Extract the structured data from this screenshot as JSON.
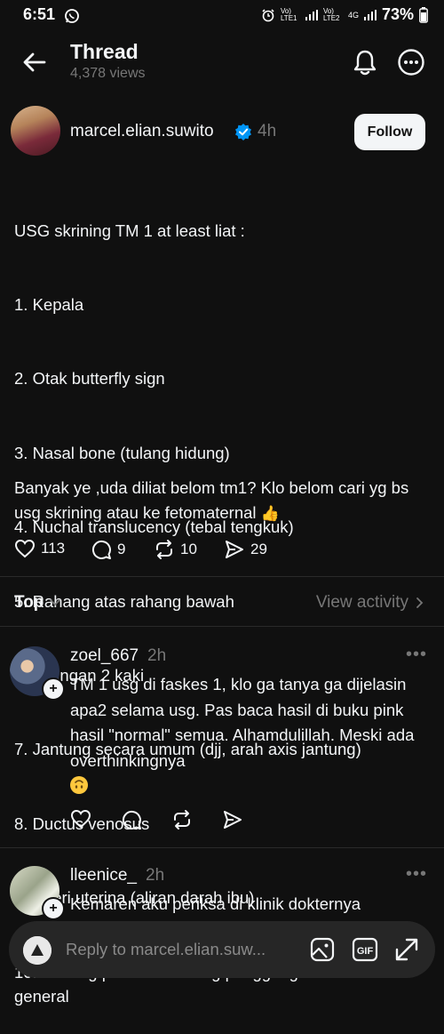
{
  "status_bar": {
    "time": "6:51",
    "battery": "73%",
    "signal_labels": [
      "Vo) LTE1",
      "Vo) LTE2",
      "4G"
    ]
  },
  "header": {
    "title": "Thread",
    "views": "4,378 views"
  },
  "post": {
    "author": "marcel.elian.suwito",
    "time": "4h",
    "follow_label": "Follow",
    "lines": [
      "USG skrining TM 1 at least liat :",
      "1. Kepala",
      "2. Otak butterfly sign",
      "3. Nasal bone (tulang hidung)",
      "4. Nuchal translucency (tebal tengkuk)",
      "5. Rahang atas rahang bawah",
      "6. 2 tangan 2 kaki",
      "7. Jantung secara umum (djj, arah axis jantung)",
      "8. Ductus venosus",
      "9. Arteri uterina (aliran darah ibu)",
      "10. Dinding perut dan tulang punggung in general"
    ],
    "text2": "Banyak ye ,uda diliat belom tm1? Klo belom cari yg bs usg skrining atau ke fetomaternal",
    "emoji": "👍",
    "likes": "113",
    "replies": "9",
    "reposts": "10",
    "shares": "29"
  },
  "sort": {
    "label": "Top",
    "view_activity": "View activity"
  },
  "replies": [
    {
      "author": "zoel_667",
      "time": "2h",
      "text": "TM 1 usg di faskes 1, klo ga tanya ga dijelasin apa2 selama usg. Pas baca hasil di buku pink hasil \"normal\" semua. Alhamdulillah. Meski ada overthinkingnya",
      "emoji": "upside-down-face"
    },
    {
      "author": "lleenice_",
      "time": "2h",
      "text": "Kemaren aku periksa di klinik dokternya"
    }
  ],
  "composer": {
    "placeholder": "Reply to marcel.elian.suw..."
  },
  "colors": {
    "background": "#101010",
    "text": "#f3f5f7",
    "muted": "#777777",
    "verified": "#0095f6"
  }
}
